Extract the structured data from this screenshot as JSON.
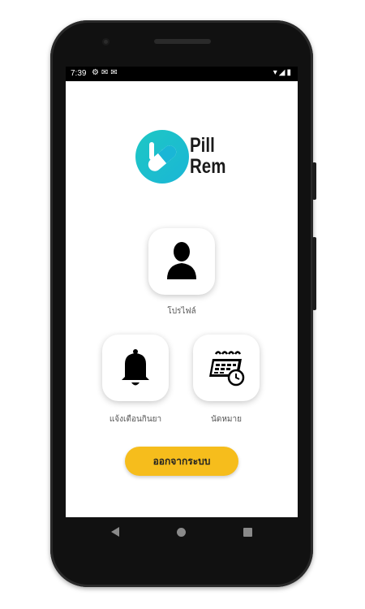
{
  "status_bar": {
    "time": "7:39",
    "left_icons": [
      "settings-icon",
      "gmail-icon",
      "gmail-icon"
    ],
    "right_icons": [
      "wifi-icon",
      "signal-icon",
      "battery-icon"
    ]
  },
  "logo": {
    "line1": "Pill",
    "line2": "Rem",
    "brand_colors": [
      "#1ec7c4",
      "#1ab6d6"
    ]
  },
  "menu": {
    "profile": {
      "label": "โปรไฟล์",
      "icon": "user-icon"
    },
    "reminder": {
      "label": "แจ้งเตือนกินยา",
      "icon": "bell-icon"
    },
    "appointment": {
      "label": "นัดหมาย",
      "icon": "calendar-clock-icon"
    }
  },
  "logout": {
    "label": "ออกจากระบบ",
    "color": "#f6bd1c"
  },
  "nav_bar": [
    "back-icon",
    "home-icon",
    "recents-icon"
  ]
}
